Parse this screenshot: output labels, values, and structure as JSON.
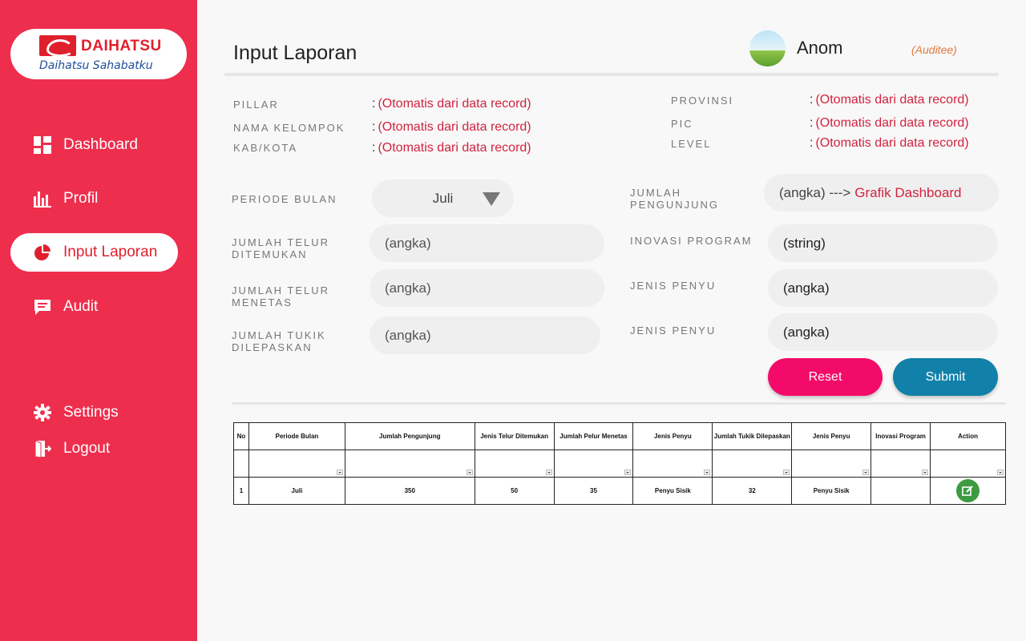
{
  "brand": {
    "name": "DAIHATSU",
    "tagline": "Daihatsu Sahabatku"
  },
  "sidebar": {
    "items": [
      {
        "label": "Dashboard",
        "icon": "dashboard-grid-icon"
      },
      {
        "label": "Profil",
        "icon": "bar-chart-icon"
      },
      {
        "label": "Input Laporan",
        "icon": "pie-chart-icon",
        "active": true
      },
      {
        "label": "Audit",
        "icon": "chat-icon"
      },
      {
        "label": "Settings",
        "icon": "gear-icon"
      },
      {
        "label": "Logout",
        "icon": "logout-icon"
      }
    ]
  },
  "header": {
    "title": "Input Laporan",
    "user_name": "Anom",
    "user_role": "(Auditee)"
  },
  "info": {
    "auto_value": "(Otomatis dari data record)",
    "left": [
      {
        "label": "PILLAR"
      },
      {
        "label": "NAMA KELOMPOK"
      },
      {
        "label": "KAB/KOTA"
      }
    ],
    "right": [
      {
        "label": "PROVINSI"
      },
      {
        "label": "PIC"
      },
      {
        "label": "LEVEL"
      }
    ]
  },
  "form": {
    "periode_label": "PERIODE BULAN",
    "periode_value": "Juli",
    "telur_ditemukan_label": "JUMLAH TELUR DITEMUKAN",
    "telur_menetas_label": "JUMLAH TELUR MENETAS",
    "tukik_label": "JUMLAH TUKIK DILEPASKAN",
    "pengunjung_label": "JUMLAH PENGUNJUNG",
    "pengunjung_value": "(angka) --->",
    "pengunjung_link": "Grafik Dashboard",
    "inovasi_label": "INOVASI PROGRAM",
    "jenis_penyu_label": "JENIS PENYU",
    "jenis_penyu_label_2": "JENIS PENYU",
    "placeholder_angka": "(angka)",
    "placeholder_string": "(string)",
    "reset_label": "Reset",
    "submit_label": "Submit"
  },
  "colors": {
    "sidebar": "#ee2e4d",
    "accent_red": "#d1233f",
    "reset": "#f20b69",
    "submit": "#1281a9",
    "edit": "#3d9b41"
  },
  "table": {
    "headers": [
      "No",
      "Periode Bulan",
      "Jumlah Pengunjung",
      "Jenis Telur Ditemukan",
      "Jumlah Pelur Menetas",
      "Jenis Penyu",
      "Jumlah Tukik Dilepaskan",
      "Jenis Penyu",
      "Inovasi Program",
      "Action"
    ],
    "rows": [
      [
        "1",
        "Juli",
        "350",
        "50",
        "35",
        "Penyu Sisik",
        "32",
        "Penyu Sisik",
        ""
      ]
    ]
  }
}
